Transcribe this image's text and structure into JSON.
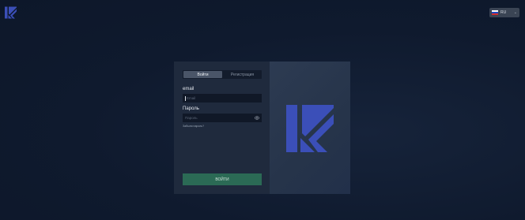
{
  "header": {
    "logo_icon": "k-logo-icon",
    "language": {
      "label": "RU",
      "flag_icon": "russia-flag-icon",
      "dropdown_icon": "chevron-down-icon"
    }
  },
  "auth_form": {
    "tabs": [
      {
        "label": "Войти",
        "active": true
      },
      {
        "label": "Регистрация",
        "active": false
      }
    ],
    "email": {
      "label": "email",
      "placeholder": "Email"
    },
    "password": {
      "label": "Пароль",
      "placeholder": "Пароль",
      "toggle_icon": "eye-icon"
    },
    "forgot_link": "Забыли пароль?",
    "submit_label": "ВОЙТИ"
  },
  "colors": {
    "background": "#0f1a2e",
    "accent_blue": "#3b4fb8",
    "submit_green": "#2b6a55"
  }
}
